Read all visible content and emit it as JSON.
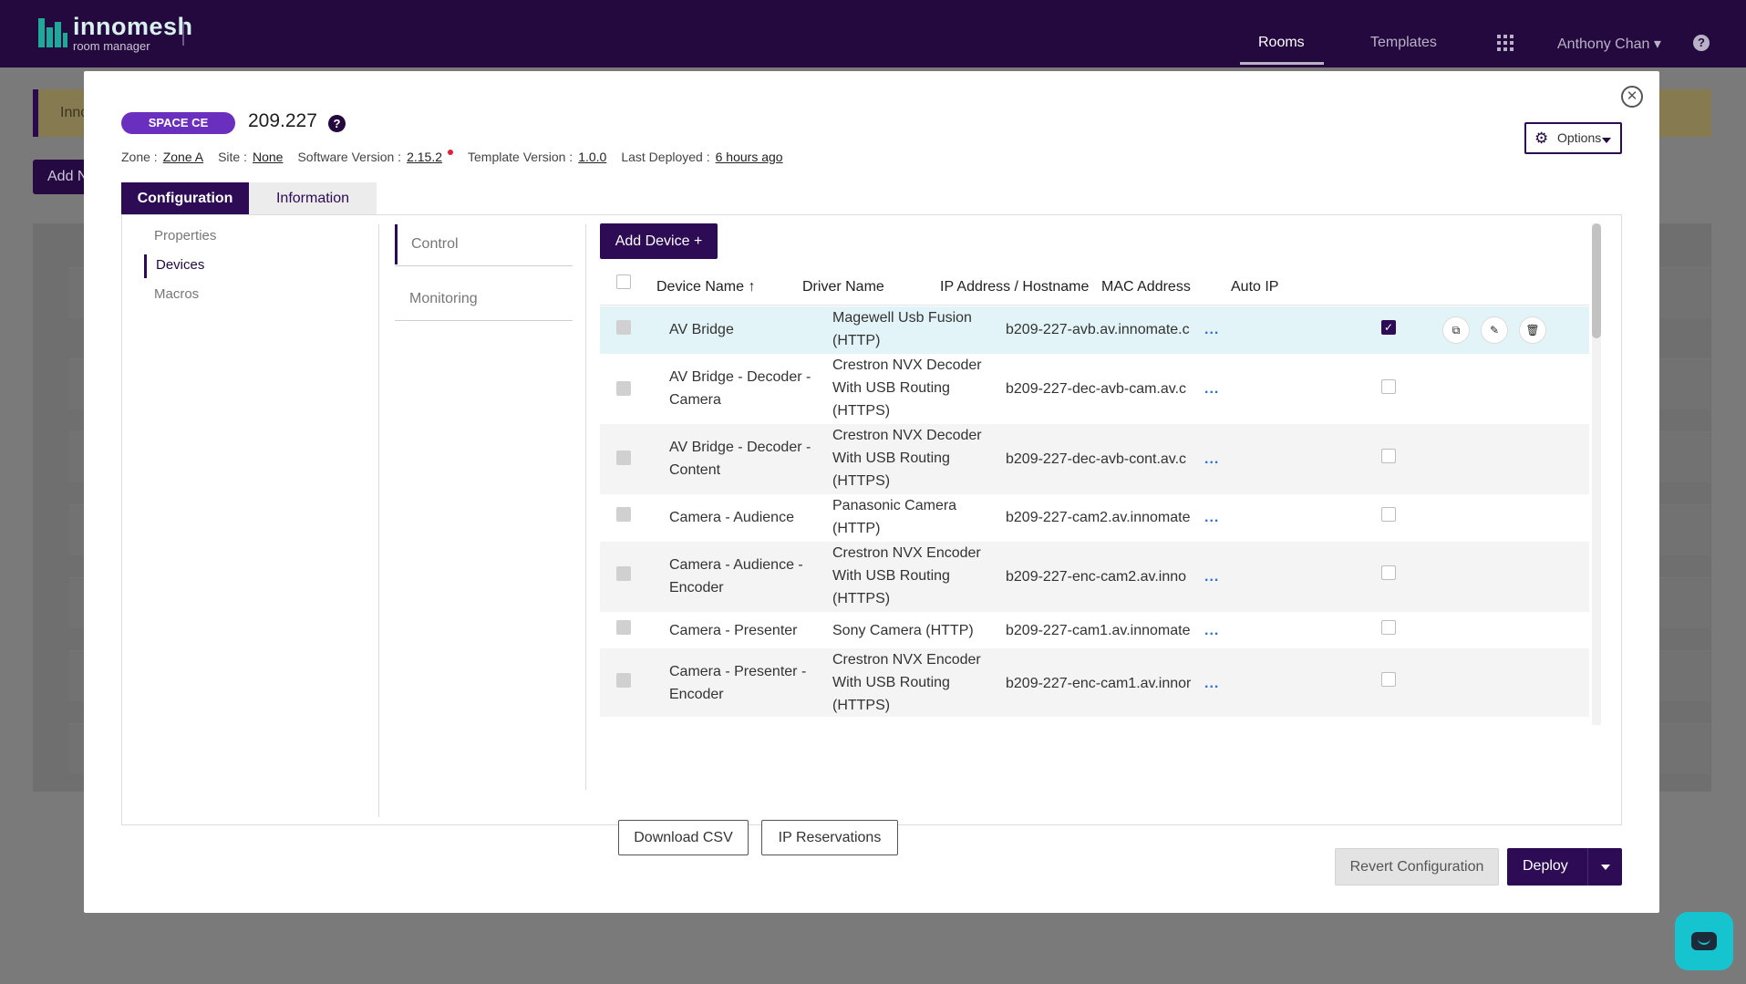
{
  "app": {
    "logo_name": "innomesh",
    "logo_sub": "room manager",
    "nav": {
      "rooms": "Rooms",
      "templates": "Templates",
      "user": "Anthony Chan ▾",
      "help": "?"
    }
  },
  "background": {
    "banner_text": "Inno",
    "add_button": "Add N"
  },
  "modal": {
    "close": "✕",
    "badge": "SPACE CE",
    "room_id": "209.227",
    "help": "?",
    "meta": {
      "zone_label": "Zone :",
      "zone_value": "Zone A",
      "site_label": "Site :",
      "site_value": "None",
      "software_label": "Software Version :",
      "software_value": "2.15.2",
      "template_label": "Template Version :",
      "template_value": "1.0.0",
      "deployed_label": "Last Deployed :",
      "deployed_value": "6 hours ago"
    },
    "options": {
      "label": "Options",
      "icon": "gear-icon"
    },
    "tabs": {
      "configuration": "Configuration",
      "information": "Information"
    },
    "side_menu": {
      "properties": "Properties",
      "devices": "Devices",
      "macros": "Macros"
    },
    "sub_menu": {
      "control": "Control",
      "monitoring": "Monitoring"
    },
    "add_device": "Add Device +",
    "table": {
      "headers": {
        "device_name": "Device Name",
        "sort_icon": "↑",
        "driver_name": "Driver Name",
        "ip": "IP Address / Hostname",
        "mac": "MAC Address",
        "auto_ip": "Auto IP"
      },
      "more": "...",
      "rows": [
        {
          "name": "AV Bridge",
          "driver": "Magewell Usb Fusion (HTTP)",
          "ip": "b209-227-avb.av.innomate.c",
          "auto_ip": true
        },
        {
          "name": "AV Bridge - Decoder - Camera",
          "driver": "Crestron NVX Decoder With USB Routing (HTTPS)",
          "ip": "b209-227-dec-avb-cam.av.c",
          "auto_ip": false
        },
        {
          "name": "AV Bridge - Decoder - Content",
          "driver": "Crestron NVX Decoder With USB Routing (HTTPS)",
          "ip": "b209-227-dec-avb-cont.av.c",
          "auto_ip": false
        },
        {
          "name": "Camera - Audience",
          "driver": "Panasonic Camera (HTTP)",
          "ip": "b209-227-cam2.av.innomate",
          "auto_ip": false
        },
        {
          "name": "Camera - Audience - Encoder",
          "driver": "Crestron NVX Encoder With USB Routing (HTTPS)",
          "ip": "b209-227-enc-cam2.av.inno",
          "auto_ip": false
        },
        {
          "name": "Camera - Presenter",
          "driver": "Sony Camera (HTTP)",
          "ip": "b209-227-cam1.av.innomate",
          "auto_ip": false
        },
        {
          "name": "Camera - Presenter - Encoder",
          "driver": "Crestron NVX Encoder With USB Routing (HTTPS)",
          "ip": "b209-227-enc-cam1.av.innor",
          "auto_ip": false
        }
      ],
      "row_actions": {
        "copy": "⧉",
        "edit": "✎",
        "delete": "🗑"
      }
    },
    "download_csv": "Download CSV",
    "ip_reservations": "IP Reservations",
    "revert": "Revert Configuration",
    "deploy": "Deploy"
  }
}
